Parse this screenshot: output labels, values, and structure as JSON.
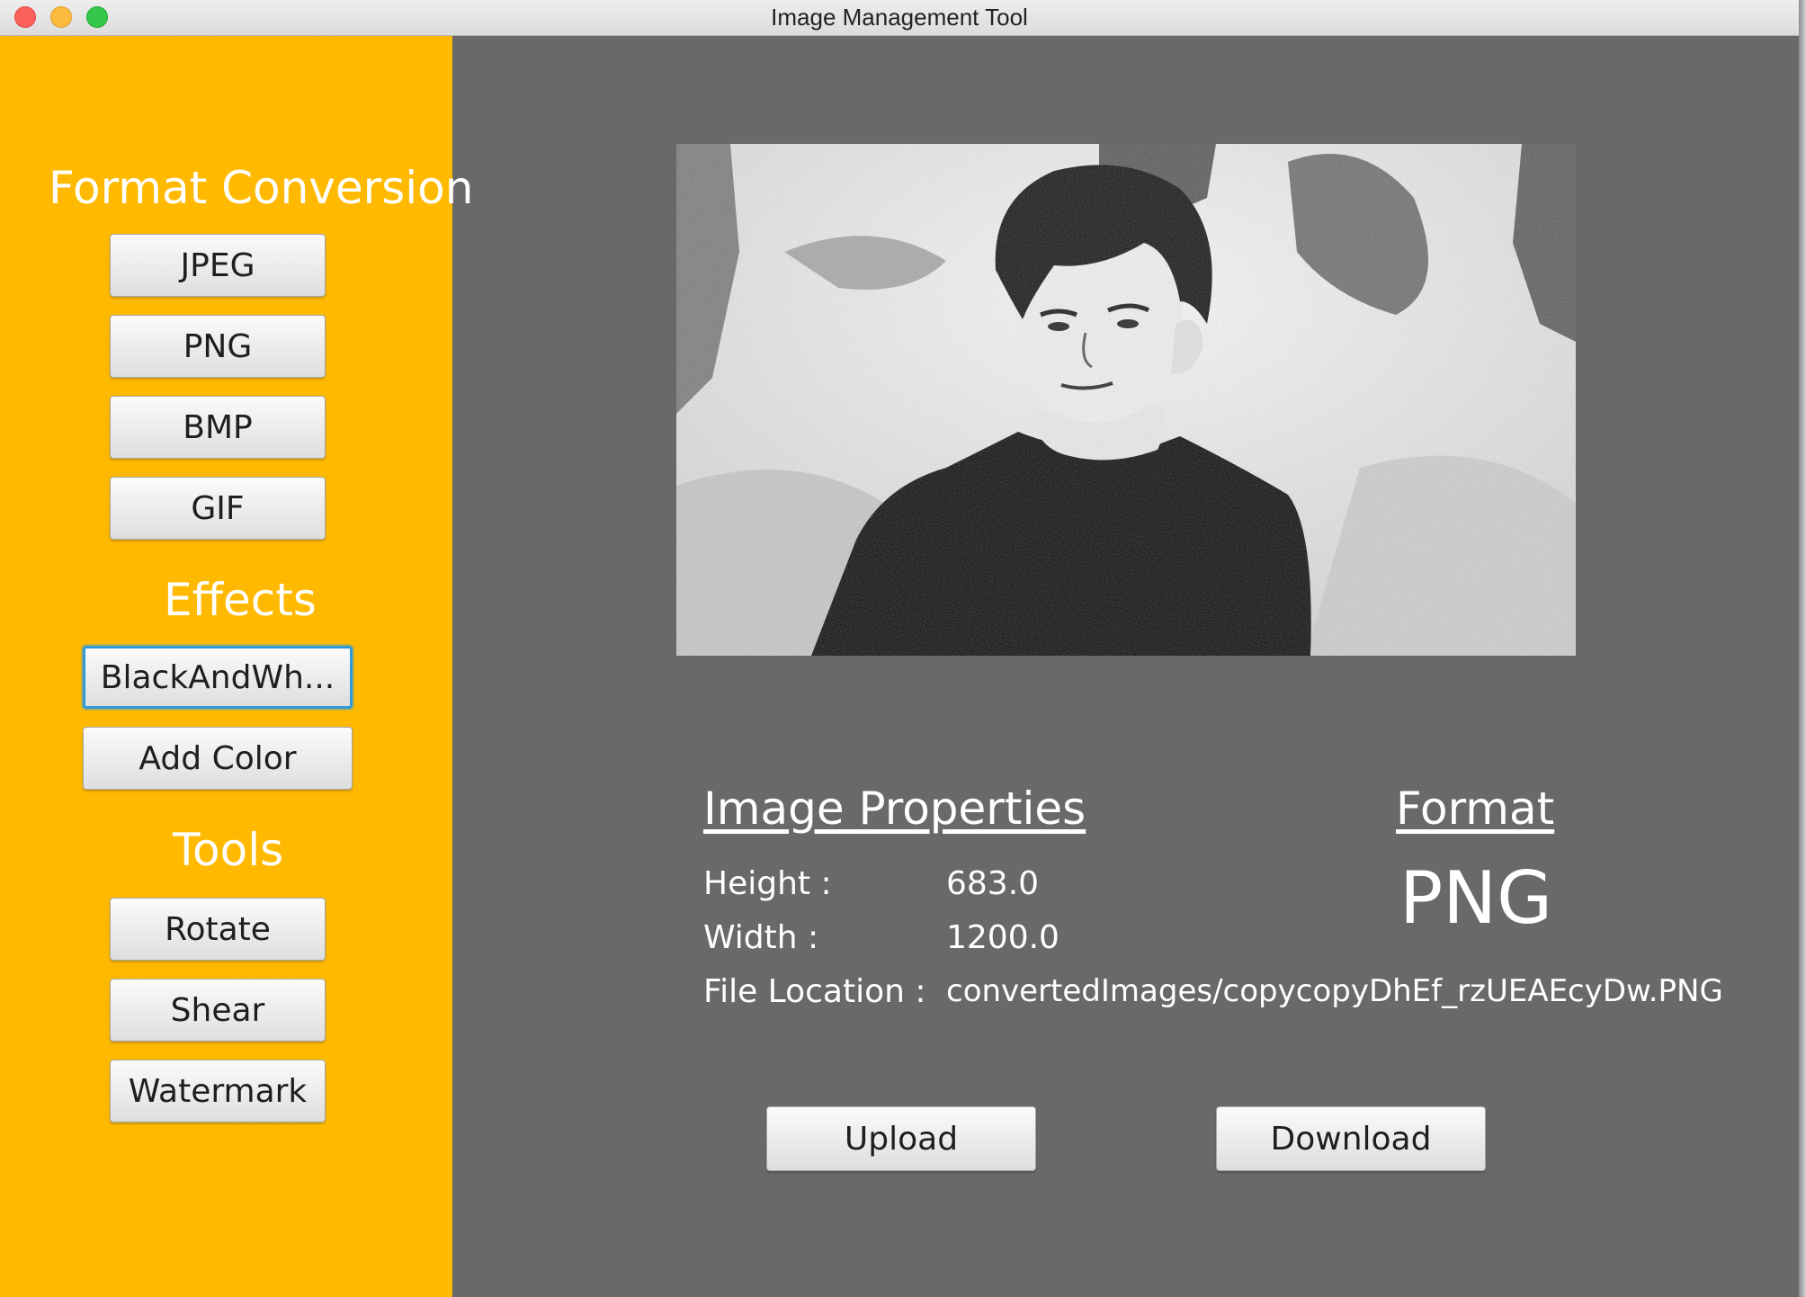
{
  "window": {
    "title": "Image Management Tool"
  },
  "sidebar": {
    "format_conversion": {
      "title": "Format Conversion",
      "buttons": [
        "JPEG",
        "PNG",
        "BMP",
        "GIF"
      ]
    },
    "effects": {
      "title": "Effects",
      "buttons": [
        "BlackAndWh...",
        "Add Color"
      ]
    },
    "tools": {
      "title": "Tools",
      "buttons": [
        "Rotate",
        "Shear",
        "Watermark"
      ]
    }
  },
  "properties": {
    "title": "Image Properties",
    "height_label": "Height  :",
    "height_value": "683.0",
    "width_label": "Width :",
    "width_value": "1200.0",
    "location_label": "File Location :",
    "location_value": "convertedImages/copycopyDhEf_rzUEAEcyDw.PNG"
  },
  "format": {
    "title": "Format",
    "value": "PNG"
  },
  "actions": {
    "upload": "Upload",
    "download": "Download"
  },
  "colors": {
    "sidebar": "#ffb900",
    "main": "#696969",
    "focus": "#2e9ad8"
  }
}
